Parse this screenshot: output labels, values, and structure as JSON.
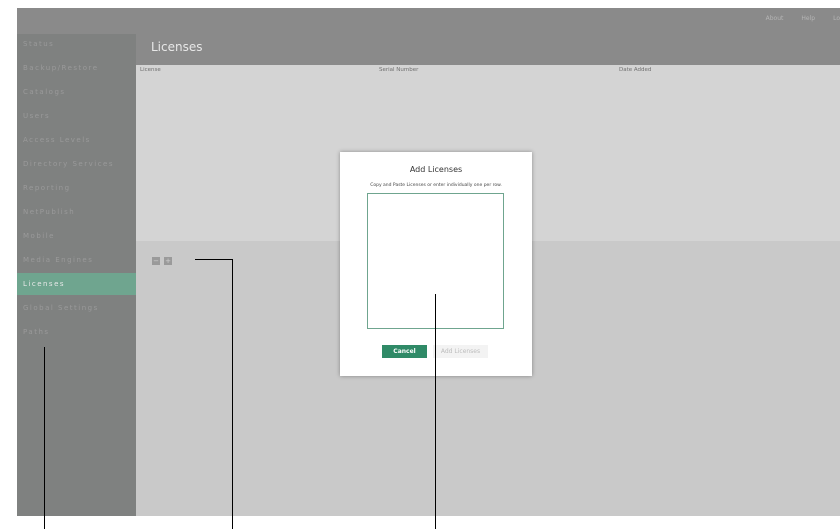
{
  "topnav": [
    "About",
    "Help",
    "Lo"
  ],
  "sidebar": {
    "items": [
      {
        "label": "Status"
      },
      {
        "label": "Backup/Restore"
      },
      {
        "label": "Catalogs"
      },
      {
        "label": "Users"
      },
      {
        "label": "Access Levels"
      },
      {
        "label": "Directory Services"
      },
      {
        "label": "Reporting"
      },
      {
        "label": "NetPublish"
      },
      {
        "label": "Mobile"
      },
      {
        "label": "Media Engines"
      },
      {
        "label": "Licenses",
        "active": true
      },
      {
        "label": "Global Settings"
      },
      {
        "label": "Paths"
      }
    ]
  },
  "page": {
    "title": "Licenses"
  },
  "table": {
    "columns": [
      "License",
      "Serial Number",
      "Date Added"
    ]
  },
  "controls": {
    "remove_label": "−",
    "add_label": "+"
  },
  "modal": {
    "title": "Add Licenses",
    "subtitle": "Copy and Paste Licenses or enter individually one per row.",
    "textarea_value": "",
    "cancel_label": "Cancel",
    "add_label": "Add Licenses"
  },
  "colors": {
    "accent": "#2f8a67",
    "active_item": "#6fa58f",
    "overlay_gray": "#8a8a8a"
  }
}
